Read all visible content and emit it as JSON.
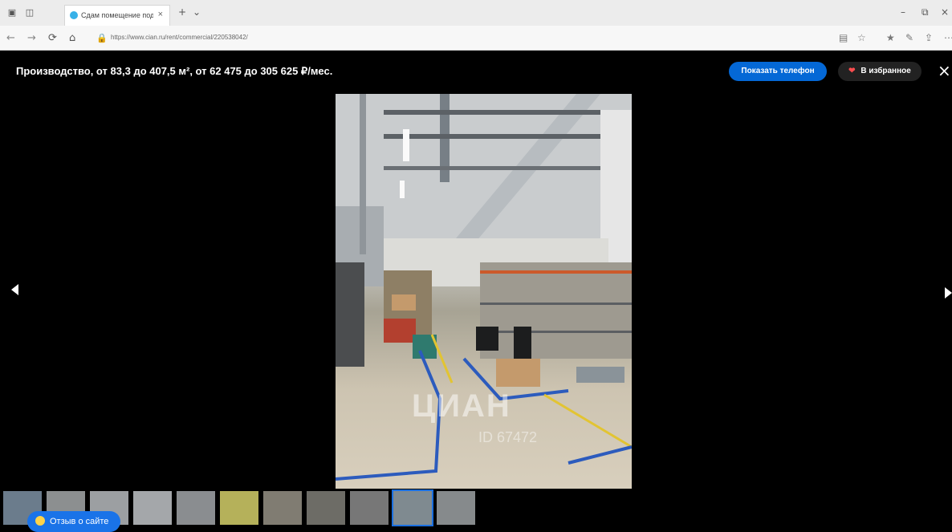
{
  "browser": {
    "tab_title": "Сдам помещение под",
    "tab_close": "×",
    "new_tab": "+",
    "tab_menu": "⌄",
    "url": "https://www.cian.ru/rent/commercial/220538042/",
    "win_min": "–",
    "win_restore": "⧉",
    "win_close": "×"
  },
  "nav": {
    "back": "←",
    "forward": "→",
    "reload": "⟳",
    "home": "⌂",
    "lock": "🔒",
    "reading": "▤",
    "star": "☆",
    "fav_bar": "★",
    "notes": "✎",
    "share": "⇪",
    "more": "⋯"
  },
  "gallery": {
    "title": "Производство, от 83,3 до 407,5 м², от 62 475 до 305 625 ₽/мес.",
    "show_phone": "Показать телефон",
    "favorite": "В избранное",
    "close": "×",
    "watermark": "ЦИАН",
    "watermark_id": "ID 67472",
    "thumbnails_count": 11,
    "active_thumb_index": 9
  },
  "feedback": {
    "label": "Отзыв о сайте"
  }
}
